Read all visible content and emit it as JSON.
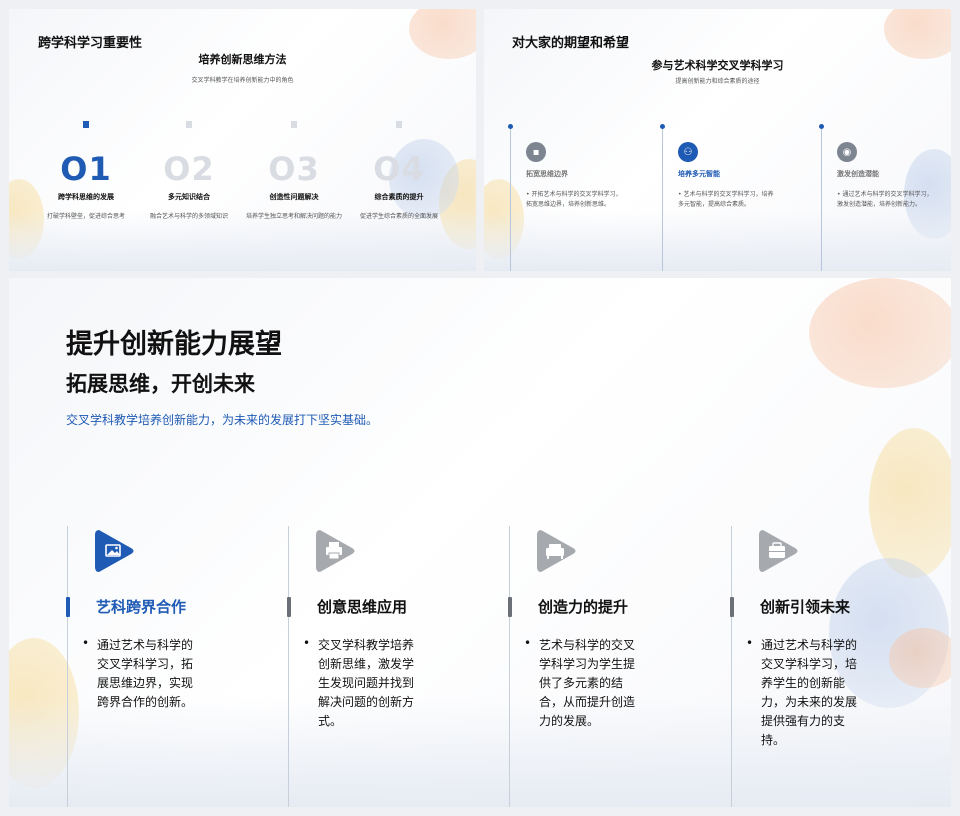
{
  "slide1": {
    "title": "跨学科学习重要性",
    "subtitle": "培养创新思维方法",
    "caption": "交叉学科教学在培养创新能力中的角色",
    "items": [
      {
        "num": "O1",
        "heading": "跨学科思维的发展",
        "desc": "打破学科壁垒，促进综合思考",
        "active": true
      },
      {
        "num": "O2",
        "heading": "多元知识结合",
        "desc": "融合艺术与科学的多领域知识",
        "active": false
      },
      {
        "num": "O3",
        "heading": "创造性问题解决",
        "desc": "培养学生独立思考和解决问题的能力",
        "active": false
      },
      {
        "num": "O4",
        "heading": "综合素质的提升",
        "desc": "促进学生综合素质的全面发展",
        "active": false
      }
    ]
  },
  "slide2": {
    "title": "对大家的期望和希望",
    "subtitle": "参与艺术科学交叉学科学习",
    "caption": "提高创新能力和综合素质的途径",
    "items": [
      {
        "icon": "chat-icon",
        "glyph": "▪",
        "heading": "拓宽思维边界",
        "desc": "• 开拓艺术与科学的交叉学科学习，拓宽思维边界，培养创新思维。",
        "active": false
      },
      {
        "icon": "network-icon",
        "glyph": "⚇",
        "heading": "培养多元智能",
        "desc": "• 艺术与科学的交叉学科学习，培养多元智能，提高综合素质。",
        "active": true
      },
      {
        "icon": "target-icon",
        "glyph": "◉",
        "heading": "激发创造潜能",
        "desc": "• 通过艺术与科学的交叉学科学习，激发创造潜能，培养创新能力。",
        "active": false
      }
    ]
  },
  "slide3": {
    "title": "提升创新能力展望",
    "subtitle": "拓展思维，开创未来",
    "description": "交叉学科教学培养创新能力，为未来的发展打下坚实基础。",
    "columns": [
      {
        "icon": "image-icon",
        "heading": "艺科跨界合作",
        "bullet": "•",
        "desc": "通过艺术与科学的交叉学科学习，拓展思维边界，实现跨界合作的创新。",
        "active": true,
        "color": "#1f5ab4"
      },
      {
        "icon": "printer-icon",
        "heading": "创意思维应用",
        "bullet": "•",
        "desc": "交叉学科教学培养创新思维，激发学生发现问题并找到解决问题的创新方式。",
        "active": false,
        "color": "#a6a9ae"
      },
      {
        "icon": "sofa-icon",
        "heading": "创造力的提升",
        "bullet": "•",
        "desc": "艺术与科学的交叉学科学习为学生提供了多元素的结合，从而提升创造力的发展。",
        "active": false,
        "color": "#a6a9ae"
      },
      {
        "icon": "briefcase-icon",
        "heading": "创新引领未来",
        "bullet": "•",
        "desc": "通过艺术与科学的交叉学科学习，培养学生的创新能力，为未来的发展提供强有力的支持。",
        "active": false,
        "color": "#a6a9ae"
      }
    ]
  }
}
